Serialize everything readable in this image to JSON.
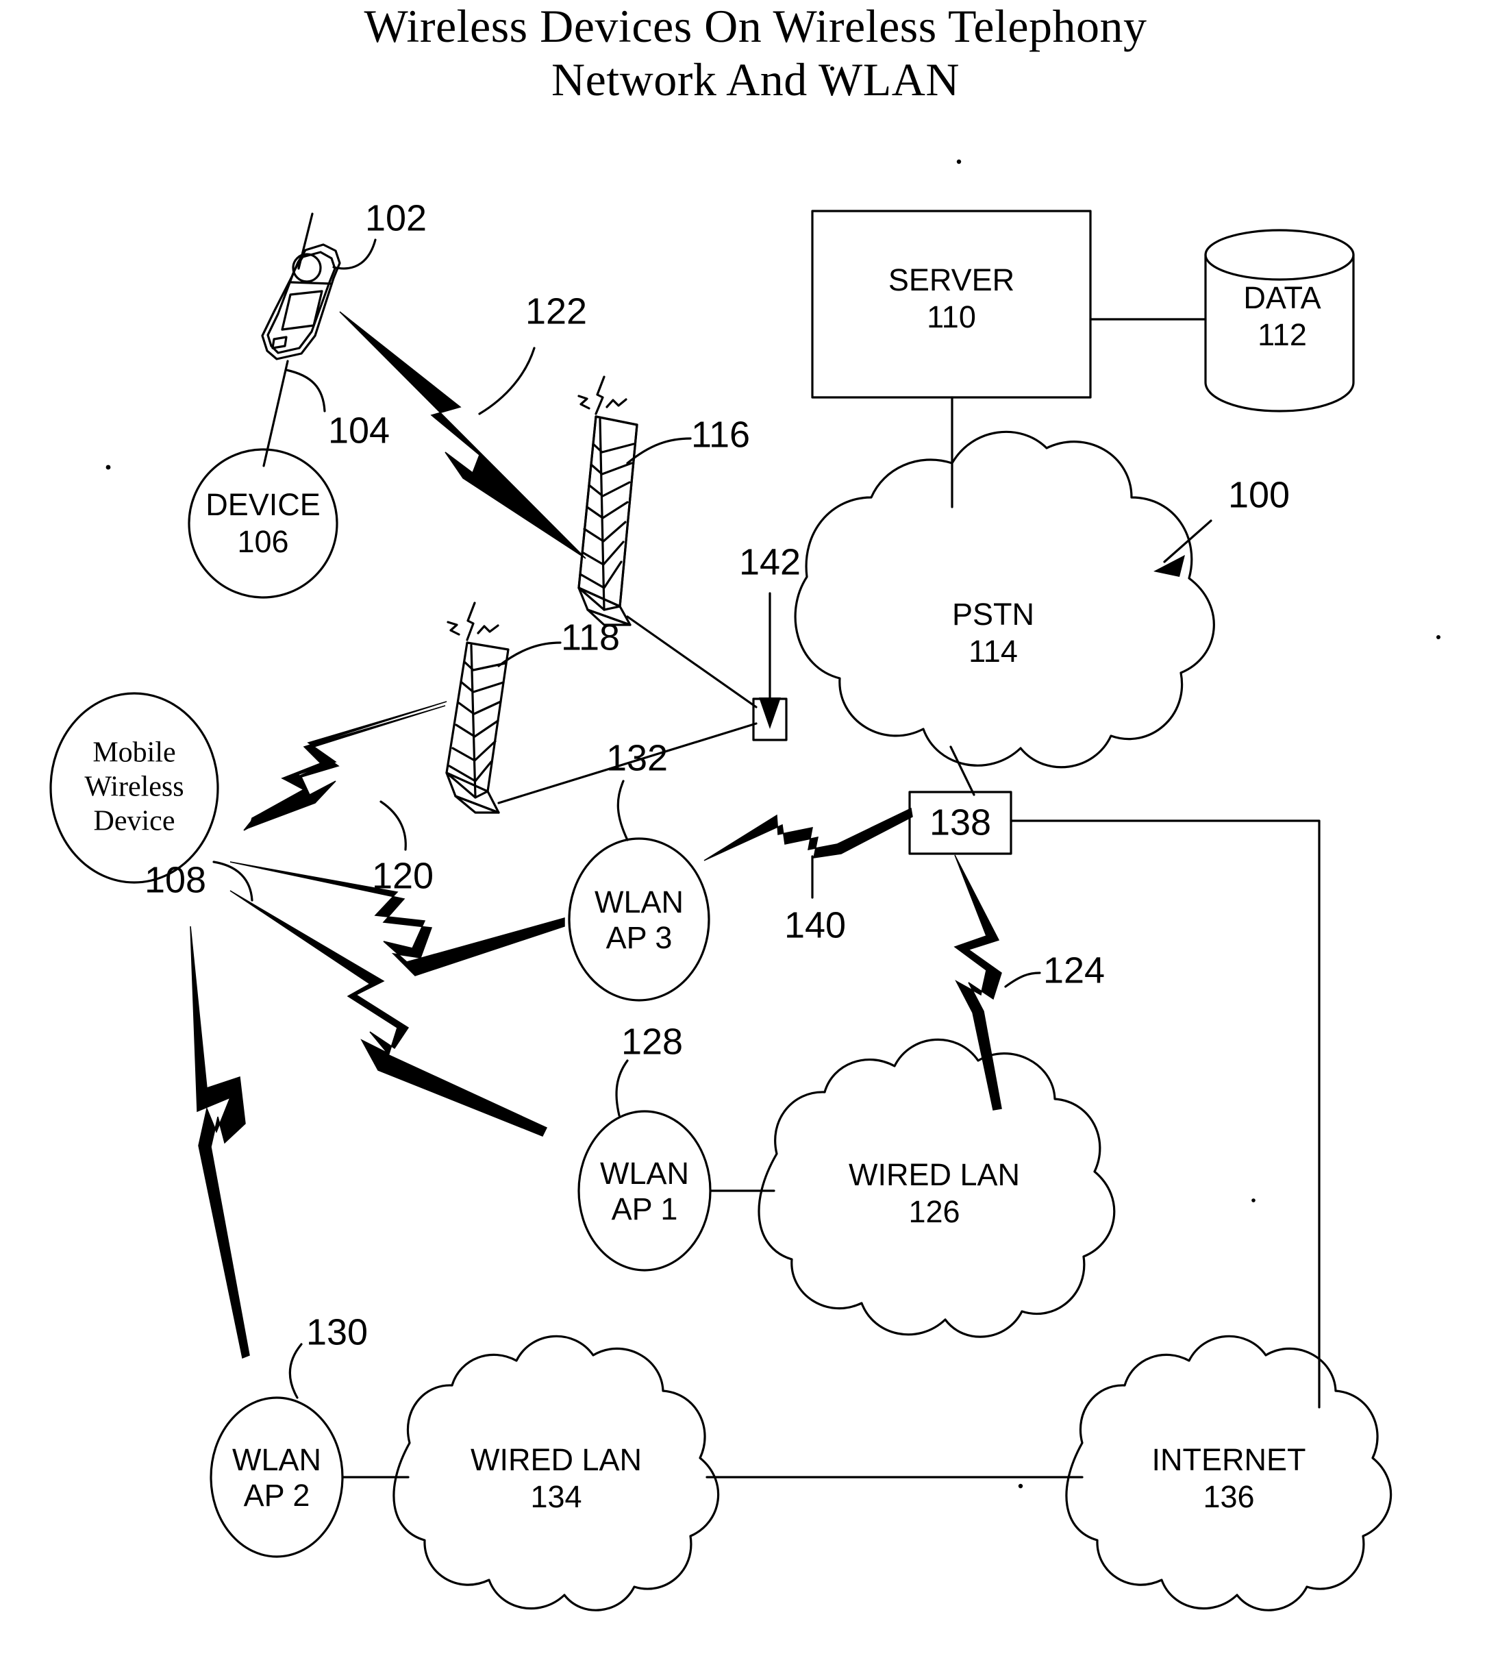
{
  "figure": {
    "title_line1": "Wireless Devices On Wireless Telephony",
    "title_line2": "Network And WLAN",
    "overall_ref": "100"
  },
  "nodes": {
    "handset": {
      "ref": "102"
    },
    "handset_to_device_lead": {
      "ref": "104"
    },
    "device": {
      "label": "DEVICE",
      "ref": "106"
    },
    "mobile_wireless_device": {
      "line1": "Mobile",
      "line2": "Wireless",
      "line3": "Device",
      "ref": "108"
    },
    "server": {
      "label": "SERVER",
      "ref": "110"
    },
    "data_store": {
      "label": "DATA",
      "ref": "112"
    },
    "pstn": {
      "label": "PSTN",
      "ref": "114"
    },
    "tower_1": {
      "ref": "116"
    },
    "tower_2": {
      "ref": "118"
    },
    "wlan_ap_1": {
      "line1": "WLAN",
      "line2": "AP 1",
      "ref": "128"
    },
    "wlan_ap_2": {
      "line1": "WLAN",
      "line2": "AP 2",
      "ref": "130"
    },
    "wlan_ap_3": {
      "line1": "WLAN",
      "line2": "AP 3",
      "ref": "132"
    },
    "wired_lan_1": {
      "label": "WIRED LAN",
      "ref": "126"
    },
    "wired_lan_2": {
      "label": "WIRED LAN",
      "ref": "134"
    },
    "internet": {
      "label": "INTERNET",
      "ref": "136"
    },
    "gateway_138": {
      "ref": "138"
    },
    "gateway_142": {
      "ref": "142"
    }
  },
  "links": {
    "bolt_handset_tower1": {
      "ref": "122"
    },
    "bolt_mobile_tower2": {
      "ref": "120"
    },
    "bolt_ap3_to_138": {
      "ref": "140"
    },
    "bolt_138_to_lan126": {
      "ref": "124"
    }
  },
  "colors": {
    "ink": "#000000",
    "paper": "#ffffff"
  }
}
